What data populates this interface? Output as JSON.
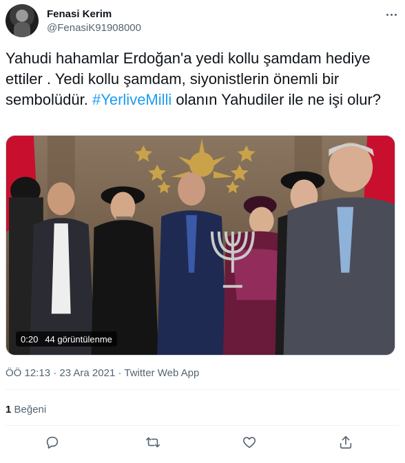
{
  "author": {
    "display_name": "Fenasi Kerim",
    "handle": "@FenasiK91908000",
    "avatar_icon": "profile-photo"
  },
  "tweet": {
    "text_before": "Yahudi hahamlar Erdoğan'a yedi kollu şamdam hediye ettiler . Yedi kollu şamdam, siyonistlerin önemli bir sembolüdür. ",
    "hashtag": "#YerliveMilli",
    "text_after": " olanın Yahudiler ile ne işi olur?",
    "hashtag_color": "#1d9bf0"
  },
  "video": {
    "duration": "0:20",
    "views": "44 görüntülenme"
  },
  "meta": {
    "time": "ÖÖ 12:13",
    "date": "23 Ara 2021",
    "source": "Twitter Web App",
    "separator": "·"
  },
  "stats": {
    "likes_count": "1",
    "likes_label": "Beğeni"
  },
  "actions": [
    {
      "icon": "reply-icon"
    },
    {
      "icon": "retweet-icon"
    },
    {
      "icon": "like-icon"
    },
    {
      "icon": "share-icon"
    }
  ],
  "colors": {
    "text_primary": "#0f1419",
    "text_secondary": "#536471",
    "link": "#1d9bf0",
    "divider": "#eff3f4"
  }
}
